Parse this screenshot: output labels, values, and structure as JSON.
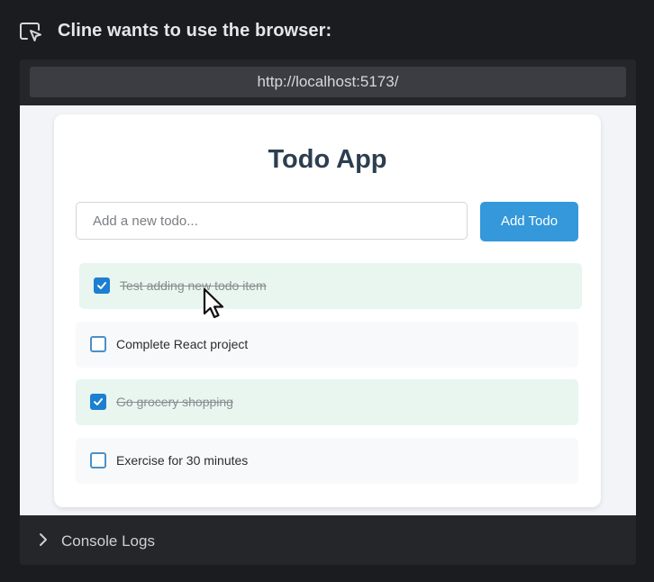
{
  "header": {
    "title": "Cline wants to use the browser:",
    "icon": "browser-cursor-icon"
  },
  "browser": {
    "url": "http://localhost:5173/"
  },
  "app": {
    "title": "Todo App",
    "input_placeholder": "Add a new todo...",
    "input_value": "",
    "add_button_label": "Add Todo",
    "accent_color": "#3498db",
    "todos": [
      {
        "text": "Test adding new todo item",
        "completed": true
      },
      {
        "text": "Complete React project",
        "completed": false
      },
      {
        "text": "Go grocery shopping",
        "completed": true
      },
      {
        "text": "Exercise for 30 minutes",
        "completed": false
      }
    ]
  },
  "console": {
    "label": "Console Logs",
    "icon": "chevron-right-icon"
  }
}
